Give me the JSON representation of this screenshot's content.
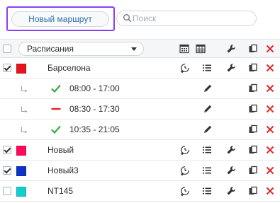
{
  "toolbar": {
    "new_route_label": "Новый маршрут",
    "search_placeholder": "Поиск",
    "search_value": ""
  },
  "header": {
    "select_value": "Расписания",
    "checkbox_checked": false
  },
  "routes": [
    {
      "name": "Барселона",
      "checked": true,
      "color": "#e8141b",
      "schedules": [
        {
          "time": "08:00 - 17:00",
          "status": "active"
        },
        {
          "time": "08:30 - 17:30",
          "status": "inactive"
        },
        {
          "time": "10:35 - 21:05",
          "status": "active"
        }
      ]
    },
    {
      "name": "Новый",
      "checked": true,
      "color": "#ff0a5a",
      "schedules": []
    },
    {
      "name": "Новый3",
      "checked": true,
      "color": "#0c33c8",
      "schedules": []
    },
    {
      "name": "NT145",
      "checked": false,
      "color": "#14cdd0",
      "schedules": []
    }
  ],
  "colors": {
    "accent": "#2d6fa8",
    "highlight_border": "#8a3ff0",
    "delete": "#e02525",
    "check_green": "#3aa83a",
    "inactive_red": "#e02525",
    "icon_dark": "#2f2f2f"
  },
  "icons": {
    "add_schedule": "clock-plus-icon",
    "list": "list-icon",
    "settings": "wrench-icon",
    "copy": "copy-icon",
    "delete": "delete-icon",
    "edit": "pencil-icon",
    "calendar": "calendar-icon",
    "table": "table-icon"
  }
}
